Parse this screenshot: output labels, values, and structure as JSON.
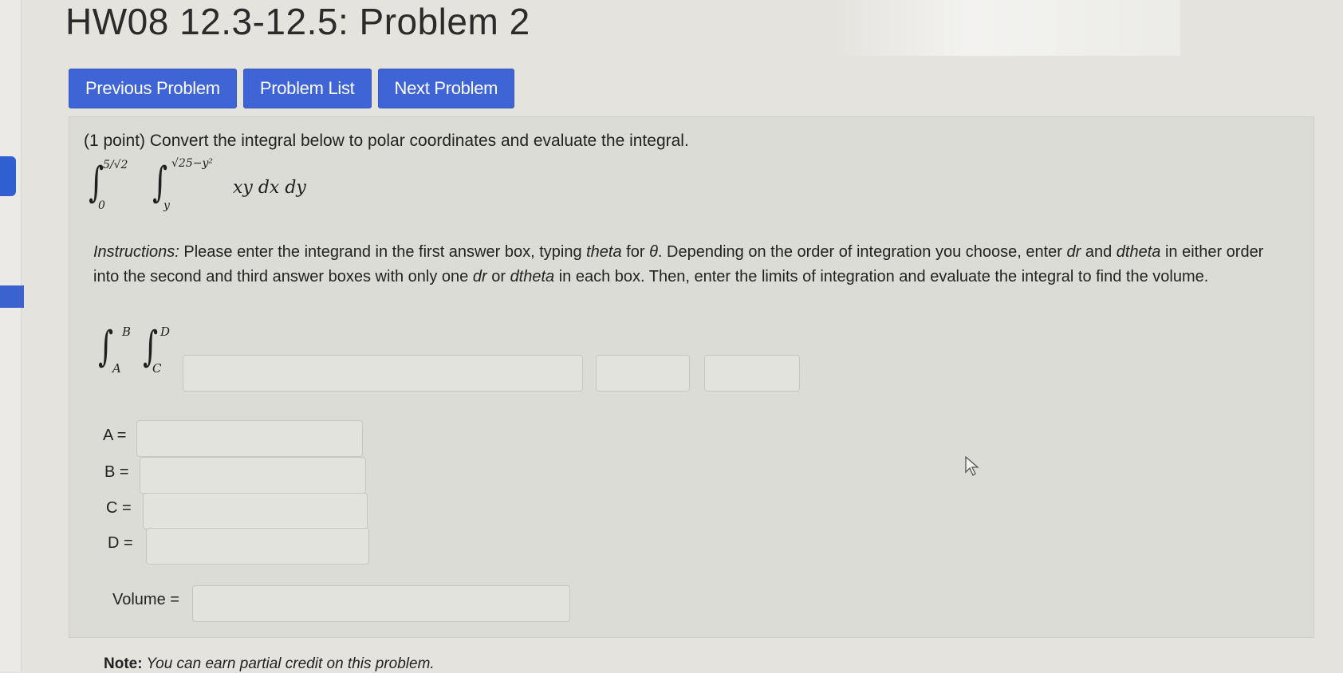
{
  "page": {
    "title": "HW08 12.3-12.5: Problem 2"
  },
  "nav": {
    "previous": "Previous Problem",
    "list": "Problem List",
    "next": "Next Problem"
  },
  "problem": {
    "prompt": "(1 point) Convert the integral below to polar coordinates and evaluate the integral.",
    "integral": {
      "outer_upper": "5/√2",
      "outer_lower": "0",
      "inner_upper": "√25−y²",
      "inner_lower": "y",
      "integrand": "xy dx dy"
    },
    "instructions": {
      "label": "Instructions:",
      "t1": " Please enter the integrand in the first answer box, typing ",
      "theta": "theta",
      "t2": " for ",
      "theta_symbol": "θ",
      "t3": ". Depending on the order of integration you choose, enter ",
      "dr": "dr",
      "t4": " and ",
      "dtheta": "dtheta",
      "t5": " in either order into the second and third answer boxes with only one ",
      "dr2": "dr",
      "t6": " or ",
      "dtheta2": "dtheta",
      "t7": " in each box. Then, enter the limits of integration and evaluate the integral to find the volume."
    },
    "answer_integral": {
      "outer_upper": "B",
      "outer_lower": "A",
      "inner_upper": "D",
      "inner_lower": "C"
    },
    "answers": {
      "integrand_value": "",
      "d1_value": "",
      "d2_value": "",
      "a_label": "A =",
      "a_value": "",
      "b_label": "B =",
      "b_value": "",
      "c_label": "C =",
      "c_value": "",
      "d_label": "D =",
      "d_value": "",
      "volume_label": "Volume =",
      "volume_value": ""
    }
  },
  "note": {
    "label": "Note:",
    "text": " You can earn partial credit on this problem."
  },
  "colors": {
    "button_blue": "#3f64d6",
    "background": "#e4e3de",
    "panel": "#dcdcd6"
  }
}
